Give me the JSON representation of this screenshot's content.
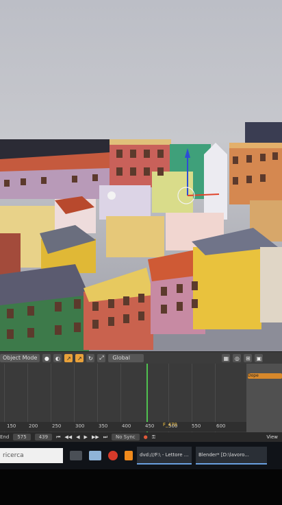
{
  "viewport": {
    "header": {
      "mode": "Object Mode",
      "pivot": "Global"
    }
  },
  "timeline": {
    "ruler_ticks": [
      "150",
      "200",
      "250",
      "300",
      "350",
      "400",
      "450",
      "500",
      "550",
      "600"
    ],
    "current_frame_label": "F_470",
    "right_panel_label": "Dope"
  },
  "controls": {
    "end_label": "End",
    "end_value": "575",
    "current_value": "439",
    "sync": "No Sync",
    "view_label": "View"
  },
  "taskbar": {
    "search_placeholder": "ricerca",
    "tasks": [
      {
        "label": "dvd:///F:\\ - Lettore ..."
      },
      {
        "label": "Blender* [D:\\lavoro..."
      }
    ]
  },
  "colors": {
    "accent": "#e8a13a",
    "playhead": "#4fc24f",
    "taskbar": "#101318"
  }
}
